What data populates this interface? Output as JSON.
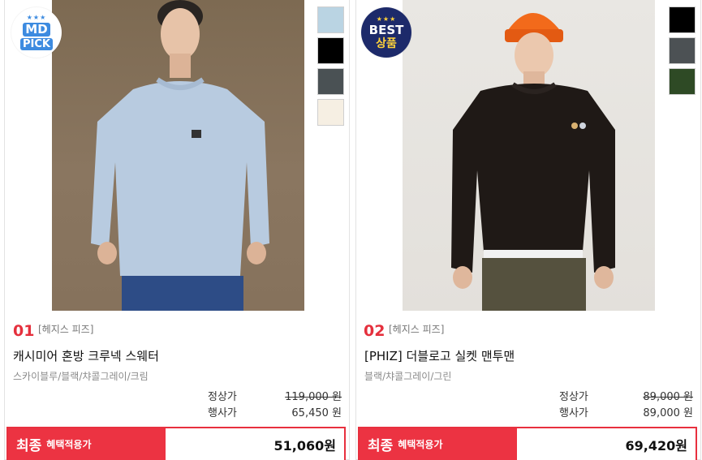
{
  "products": [
    {
      "rank": "01",
      "brand": "[헤지스 피즈]",
      "name": "캐시미어 혼방 크루넥 스웨터",
      "colors_text": "스카이블루/블랙/챠콜그레이/크림",
      "badge": {
        "stars": "★★★",
        "line1": "MD",
        "line2": "PICK"
      },
      "swatch_colors": [
        "#bad4e3",
        "#000000",
        "#4a5154",
        "#f6efe3"
      ],
      "regular_label": "정상가",
      "regular_price": "119,000 원",
      "sale_label": "행사가",
      "sale_price": "65,450 원",
      "final_title": "최종",
      "final_sub": "혜택적용가",
      "final_price": "51,060원"
    },
    {
      "rank": "02",
      "brand": "[헤지스 피즈]",
      "name": "[PHIZ] 더블로고 실켓 맨투맨",
      "colors_text": "블랙/챠콜그레이/그린",
      "badge": {
        "stars": "★★★",
        "line1": "BEST",
        "line2": "상품"
      },
      "swatch_colors": [
        "#000000",
        "#4c5154",
        "#2e4a25"
      ],
      "regular_label": "정상가",
      "regular_price": "89,000 원",
      "sale_label": "행사가",
      "sale_price": "89,000 원",
      "final_title": "최종",
      "final_sub": "혜택적용가",
      "final_price": "69,420원"
    }
  ]
}
